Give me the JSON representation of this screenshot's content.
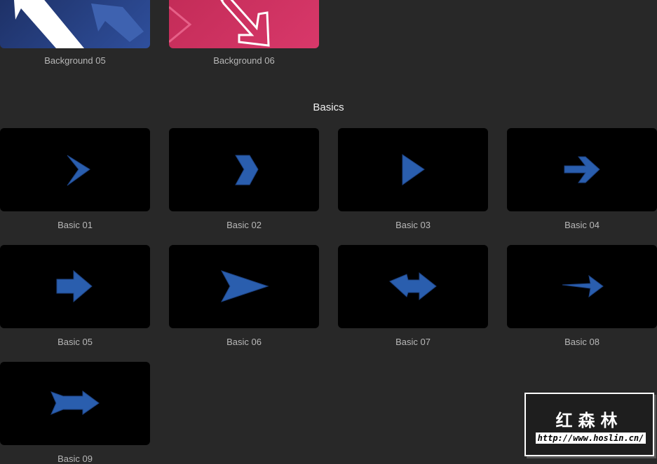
{
  "backgrounds": [
    {
      "label": "Background 05"
    },
    {
      "label": "Background 06"
    }
  ],
  "section_title": "Basics",
  "basics": [
    {
      "label": "Basic 01",
      "icon": "chevron-thin"
    },
    {
      "label": "Basic 02",
      "icon": "chevron-thick"
    },
    {
      "label": "Basic 03",
      "icon": "triangle"
    },
    {
      "label": "Basic 04",
      "icon": "arrow-line"
    },
    {
      "label": "Basic 05",
      "icon": "arrow-block"
    },
    {
      "label": "Basic 06",
      "icon": "arrow-dart"
    },
    {
      "label": "Basic 07",
      "icon": "arrow-double"
    },
    {
      "label": "Basic 08",
      "icon": "arrow-narrow"
    },
    {
      "label": "Basic 09",
      "icon": "arrow-tail"
    }
  ],
  "watermark": {
    "title": "红森林",
    "url": "http://www.hoslin.cn/"
  },
  "colors": {
    "arrow": "#2a5eae",
    "background": "#282828"
  }
}
